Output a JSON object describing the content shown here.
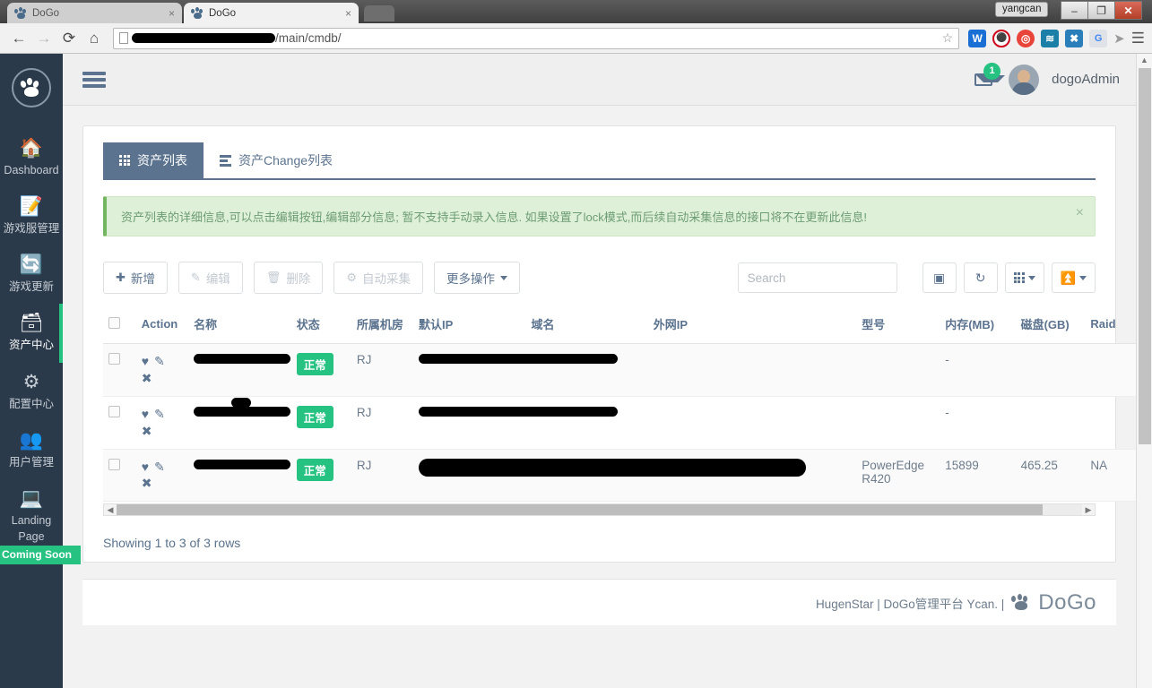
{
  "browser": {
    "tabs": [
      {
        "title": "DoGo",
        "favicon": "paw-icon",
        "close": "×"
      },
      {
        "title": "DoGo",
        "favicon": "paw-icon",
        "close": "×"
      }
    ],
    "window": {
      "user_label": "yangcan",
      "minimize": "–",
      "maximize": "❐",
      "close": "✕"
    },
    "nav": {
      "back": "←",
      "forward": "→",
      "reload": "⟳",
      "home": "⌂",
      "url_suffix": "/main/cmdb/",
      "url_redacted": true,
      "bookmark": "☆",
      "menu": "☰"
    },
    "extensions": [
      {
        "name": "word-extension-icon",
        "glyph": "W"
      },
      {
        "name": "stop-extension-icon",
        "glyph": "✋"
      },
      {
        "name": "weibo-extension-icon",
        "glyph": "◉"
      },
      {
        "name": "blue-extension-icon",
        "glyph": "≋"
      },
      {
        "name": "x-extension-icon",
        "glyph": "✖"
      },
      {
        "name": "google-translate-icon",
        "glyph": "G"
      },
      {
        "name": "cursor-icon",
        "glyph": "➤"
      }
    ]
  },
  "sidebar": {
    "logo": "paw-logo",
    "items": [
      {
        "label": "Dashboard",
        "icon": "home-icon",
        "glyph": "⌂",
        "active": false
      },
      {
        "label": "游戏服管理",
        "icon": "edit-square-icon",
        "glyph": "✎",
        "active": false
      },
      {
        "label": "游戏更新",
        "icon": "refresh-icon",
        "glyph": "↻",
        "active": false
      },
      {
        "label": "资产中心",
        "icon": "database-icon",
        "glyph": "⌸",
        "active": true
      },
      {
        "label": "配置中心",
        "icon": "gears-icon",
        "glyph": "⚙",
        "active": false
      },
      {
        "label": "用户管理",
        "icon": "users-icon",
        "glyph": "♟",
        "active": false
      },
      {
        "label": "Landing Page",
        "icon": "laptop-icon",
        "glyph": "⌸",
        "active": false,
        "badge": "Coming Soon"
      }
    ]
  },
  "topbar": {
    "menu_toggle": "hamburger-icon",
    "mail_badge": "1",
    "username": "dogoAdmin"
  },
  "tabs": [
    {
      "label": "资产列表",
      "icon": "grid-icon",
      "active": true
    },
    {
      "label": "资产Change列表",
      "icon": "list-icon",
      "active": false
    }
  ],
  "alert": {
    "text": "资产列表的详细信息,可以点击编辑按钮,编辑部分信息; 暂不支持手动录入信息. 如果设置了lock模式,而后续自动采集信息的接口将不在更新此信息!",
    "close": "×"
  },
  "toolbar": {
    "buttons": [
      {
        "label": "新增",
        "icon": "plus-icon",
        "glyph": "＋",
        "muted": false
      },
      {
        "label": "编辑",
        "icon": "edit-icon",
        "glyph": "✐",
        "muted": true
      },
      {
        "label": "删除",
        "icon": "trash-icon",
        "glyph": "Ὕ1",
        "muted": true
      },
      {
        "label": "自动采集",
        "icon": "gears-icon",
        "glyph": "⚙",
        "muted": true
      },
      {
        "label": "更多操作",
        "icon": "caret-down-icon",
        "glyph": "",
        "muted": false,
        "caret": true
      }
    ],
    "search_placeholder": "Search",
    "search_value": "",
    "icon_buttons": [
      {
        "name": "fullscreen-toggle-icon",
        "glyph": "⏵",
        "caret": false
      },
      {
        "name": "refresh-icon",
        "glyph": "↻",
        "caret": false
      },
      {
        "name": "columns-icon",
        "glyph": "grid",
        "caret": true
      },
      {
        "name": "export-icon",
        "glyph": "⤓",
        "caret": true
      }
    ]
  },
  "table": {
    "columns": [
      "Action",
      "名称",
      "状态",
      "所属机房",
      "默认IP",
      "域名",
      "外网IP",
      "型号",
      "内存(MB)",
      "磁盘(GB)",
      "Raid",
      "Raid"
    ],
    "rows": [
      {
        "name": "[redacted]",
        "status": "正常",
        "room": "RJ",
        "default_ip": "[redacted]",
        "domain": "",
        "public_ip": "",
        "model": "",
        "memory_mb": "-",
        "disk_gb": "",
        "raid1": "",
        "raid2": ""
      },
      {
        "name": "[redacted]",
        "status": "正常",
        "room": "RJ",
        "default_ip": "[redacted]",
        "domain": "",
        "public_ip": "",
        "model": "",
        "memory_mb": "-",
        "disk_gb": "",
        "raid1": "",
        "raid2": ""
      },
      {
        "name": "[redacted]",
        "status": "正常",
        "room": "RJ",
        "default_ip": "[redacted]",
        "domain": "[redacted]",
        "public_ip": "",
        "model": "PowerEdge R420",
        "memory_mb": "15899",
        "disk_gb": "465.25",
        "raid1": "NA",
        "raid2": "NA"
      }
    ],
    "row_actions": [
      {
        "name": "favorite-icon",
        "glyph": "♥"
      },
      {
        "name": "edit-icon",
        "glyph": "✎"
      },
      {
        "name": "delete-icon",
        "glyph": "✖"
      }
    ],
    "showing_text": "Showing 1 to 3 of 3 rows",
    "hscroll_left_arrow": "◀",
    "hscroll_right_arrow": "▶"
  },
  "footer": {
    "text": "HugenStar | DoGo管理平台 Ycan. |",
    "brand": "DoGo"
  },
  "colors": {
    "sidebar_bg": "#2b3a4a",
    "accent_green": "#26c281",
    "tab_active": "#5b738e",
    "alert_bg": "#dff0d8",
    "text_muted": "#6d7c8c"
  }
}
